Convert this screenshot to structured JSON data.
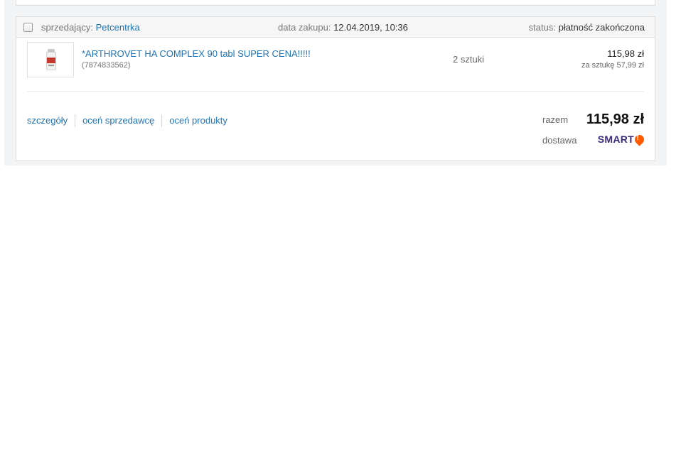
{
  "header": {
    "seller_label": "sprzedający:",
    "seller_name": "Petcentrka",
    "date_label": "data zakupu:",
    "date_value": "12.04.2019, 10:36",
    "status_label": "status:",
    "status_value": "płatność zakończona"
  },
  "item": {
    "title": "*ARTHROVET HA COMPLEX 90 tabl SUPER CENA!!!!!",
    "id": "(7874833562)",
    "quantity": "2 sztuki",
    "price": "115,98 zł",
    "unit_price": "za sztukę 57,99 zł"
  },
  "actions": {
    "details": "szczegóły",
    "rate_seller": "oceń sprzedawcę",
    "rate_products": "oceń produkty"
  },
  "summary": {
    "total_label": "razem",
    "total_value": "115,98 zł",
    "delivery_label": "dostawa",
    "delivery_brand": "SMART"
  },
  "colors": {
    "link": "#1f73b7",
    "smart_text": "#3a2a7a",
    "smart_pin": "#ff5a00"
  },
  "icons": {
    "checkbox": "checkbox-icon",
    "product_thumbnail": "product-bottle-icon",
    "smart_pin": "smart-location-pin-icon"
  }
}
